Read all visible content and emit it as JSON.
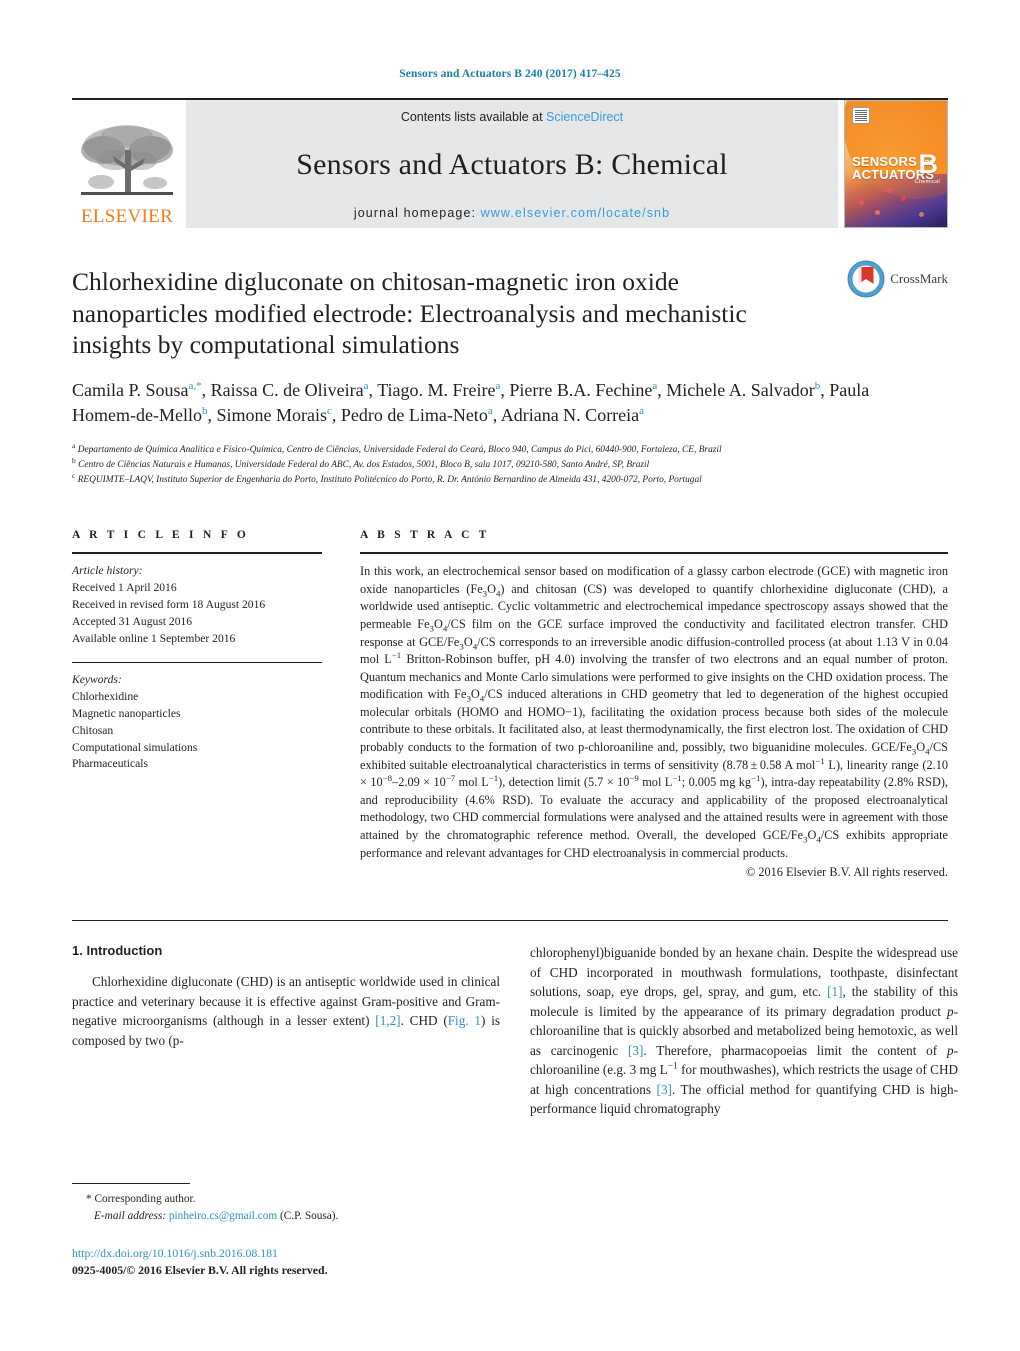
{
  "running_head": "Sensors and Actuators B 240 (2017) 417–425",
  "masthead": {
    "publisher_logo_text": "ELSEVIER",
    "contents_prefix": "Contents lists available at ",
    "contents_link": "ScienceDirect",
    "journal_title": "Sensors and Actuators B: Chemical",
    "homepage_prefix": "journal homepage: ",
    "homepage_url": "www.elsevier.com/locate/snb",
    "cover": {
      "line1": "SENSORS",
      "and": "and",
      "line2": "ACTUATORS",
      "volume_letter": "B",
      "subtitle": "Chemical"
    }
  },
  "crossmark": {
    "label": "CrossMark"
  },
  "article": {
    "title": "Chlorhexidine digluconate on chitosan-magnetic iron oxide nanoparticles modified electrode: Electroanalysis and mechanistic insights by computational simulations",
    "authors_html": "Camila P. Sousa<sup>a,*</sup>, Raissa C. de Oliveira<sup>a</sup>, Tiago. M. Freire<sup>a</sup>, Pierre B.A. Fechine<sup>a</sup>, Michele A. Salvador<sup>b</sup>, Paula Homem-de-Mello<sup>b</sup>, Simone Morais<sup>c</sup>, Pedro de Lima-Neto<sup>a</sup>, Adriana N. Correia<sup>a</sup>",
    "affiliations": [
      "a Departamento de Química Analítica e Físico-Química, Centro de Ciências, Universidade Federal do Ceará, Bloco 940, Campus do Pici, 60440-900, Fortaleza, CE, Brazil",
      "b Centro de Ciências Naturais e Humanas, Universidade Federal do ABC, Av. dos Estados, 5001, Bloco B, sala 1017, 09210-580, Santo André, SP, Brazil",
      "c REQUIMTE–LAQV, Instituto Superior de Engenharia do Porto, Instituto Politécnico do Porto, R. Dr. António Bernardino de Almeida 431, 4200-072, Porto, Portugal"
    ]
  },
  "article_info": {
    "heading": "A R T I C L E   I N F O",
    "history_label": "Article history:",
    "history": [
      "Received 1 April 2016",
      "Received in revised form 18 August 2016",
      "Accepted 31 August 2016",
      "Available online 1 September 2016"
    ],
    "keywords_label": "Keywords:",
    "keywords": [
      "Chlorhexidine",
      "Magnetic nanoparticles",
      "Chitosan",
      "Computational simulations",
      "Pharmaceuticals"
    ]
  },
  "abstract": {
    "heading": "A B S T R A C T",
    "text_html": "In this work, an electrochemical sensor based on modification of a glassy carbon electrode (GCE) with magnetic iron oxide nanoparticles (Fe<sub>3</sub>O<sub>4</sub>) and chitosan (CS) was developed to quantify chlorhexidine digluconate (CHD), a worldwide used antiseptic. Cyclic voltammetric and electrochemical impedance spectroscopy assays showed that the permeable Fe<sub>3</sub>O<sub>4</sub>/CS film on the GCE surface improved the conductivity and facilitated electron transfer. CHD response at GCE/Fe<sub>3</sub>O<sub>4</sub>/CS corresponds to an irreversible anodic diffusion-controlled process (at about 1.13 V in 0.04 mol L<sup>−1</sup> Britton-Robinson buffer, pH 4.0) involving the transfer of two electrons and an equal number of proton. Quantum mechanics and Monte Carlo simulations were performed to give insights on the CHD oxidation process. The modification with Fe<sub>3</sub>O<sub>4</sub>/CS induced alterations in CHD geometry that led to degeneration of the highest occupied molecular orbitals (HOMO and HOMO−1), facilitating the oxidation process because both sides of the molecule contribute to these orbitals. It facilitated also, at least thermodynamically, the first electron lost. The oxidation of CHD probably conducts to the formation of two p-chloroaniline and, possibly, two biguanidine molecules. GCE/Fe<sub>3</sub>O<sub>4</sub>/CS exhibited suitable electroanalytical characteristics in terms of sensitivity (8.78&thinsp;±&thinsp;0.58 A mol<sup>−1</sup> L), linearity range (2.10 × 10<sup>−8</sup>–2.09 × 10<sup>−7</sup> mol L<sup>−1</sup>), detection limit (5.7 × 10<sup>−9</sup> mol L<sup>−1</sup>; 0.005 mg kg<sup>−1</sup>), intra-day repeatability (2.8% RSD), and reproducibility (4.6% RSD). To evaluate the accuracy and applicability of the proposed electroanalytical methodology, two CHD commercial formulations were analysed and the attained results were in agreement with those attained by the chromatographic reference method. Overall, the developed GCE/Fe<sub>3</sub>O<sub>4</sub>/CS exhibits appropriate performance and relevant advantages for CHD electroanalysis in commercial products.",
    "copyright": "© 2016 Elsevier B.V. All rights reserved."
  },
  "introduction": {
    "section_number_title": "1.  Introduction",
    "col_left_html": "Chlorhexidine digluconate (CHD) is an antiseptic worldwide used in clinical practice and veterinary because it is effective against Gram-positive and Gram-negative microorganisms (although in a lesser extent) <span class=\"ref\">[1,2]</span>. CHD (<span class=\"ref\">Fig. 1</span>) is composed by two (p-",
    "col_right_html": "chlorophenyl)biguanide bonded by an hexane chain. Despite the widespread use of CHD incorporated in mouthwash formulations, toothpaste, disinfectant solutions, soap, eye drops, gel, spray, and gum, etc. <span class=\"ref\">[1]</span>, the stability of this molecule is limited by the appearance of its primary degradation product <i>p</i>-chloroaniline that is quickly absorbed and metabolized being hemotoxic, as well as carcinogenic <span class=\"ref\">[3]</span>. Therefore, pharmacopoeias limit the content of <i>p</i>-chloroaniline (e.g. 3 mg L<sup>−1</sup> for mouthwashes), which restricts the usage of CHD at high concentrations <span class=\"ref\">[3]</span>. The official method for quantifying CHD is high-performance liquid chromatography"
  },
  "footnote": {
    "corresponding_author": "* Corresponding author.",
    "email_label": "E-mail address:",
    "email": "pinheiro.cs@gmail.com",
    "email_owner": "(C.P. Sousa).",
    "doi": "http://dx.doi.org/10.1016/j.snb.2016.08.181",
    "issn_line": "0925-4005/© 2016 Elsevier B.V. All rights reserved."
  },
  "colors": {
    "link": "#2f8fc4",
    "running_head": "#1a7fa8",
    "elsevier_orange": "#f07c1e",
    "band_gray": "#e6e7e8"
  }
}
